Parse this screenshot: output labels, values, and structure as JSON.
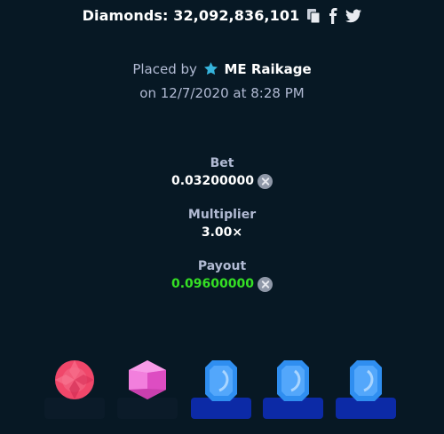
{
  "header": {
    "title": "Diamonds: 32,092,836,101",
    "icons": [
      "copy-icon",
      "facebook-icon",
      "twitter-icon"
    ]
  },
  "placed": {
    "prefix": "Placed by",
    "user": "ME Raikage",
    "date_line": "on 12/7/2020 at 8:28 PM"
  },
  "bet": {
    "label": "Bet",
    "value": "0.03200000"
  },
  "multiplier": {
    "label": "Multiplier",
    "value": "3.00×"
  },
  "payout": {
    "label": "Payout",
    "value": "0.09600000"
  },
  "colors": {
    "background": "#071824",
    "payout_green": "#35e024",
    "muted_text": "#b1bad3",
    "picked_base": "#0c2aa6"
  },
  "tiles": [
    {
      "gem": "red-gem",
      "state": "revealed"
    },
    {
      "gem": "pink-gem",
      "state": "revealed"
    },
    {
      "gem": "blue-gem",
      "state": "picked"
    },
    {
      "gem": "blue-gem",
      "state": "picked"
    },
    {
      "gem": "blue-gem",
      "state": "picked"
    }
  ]
}
